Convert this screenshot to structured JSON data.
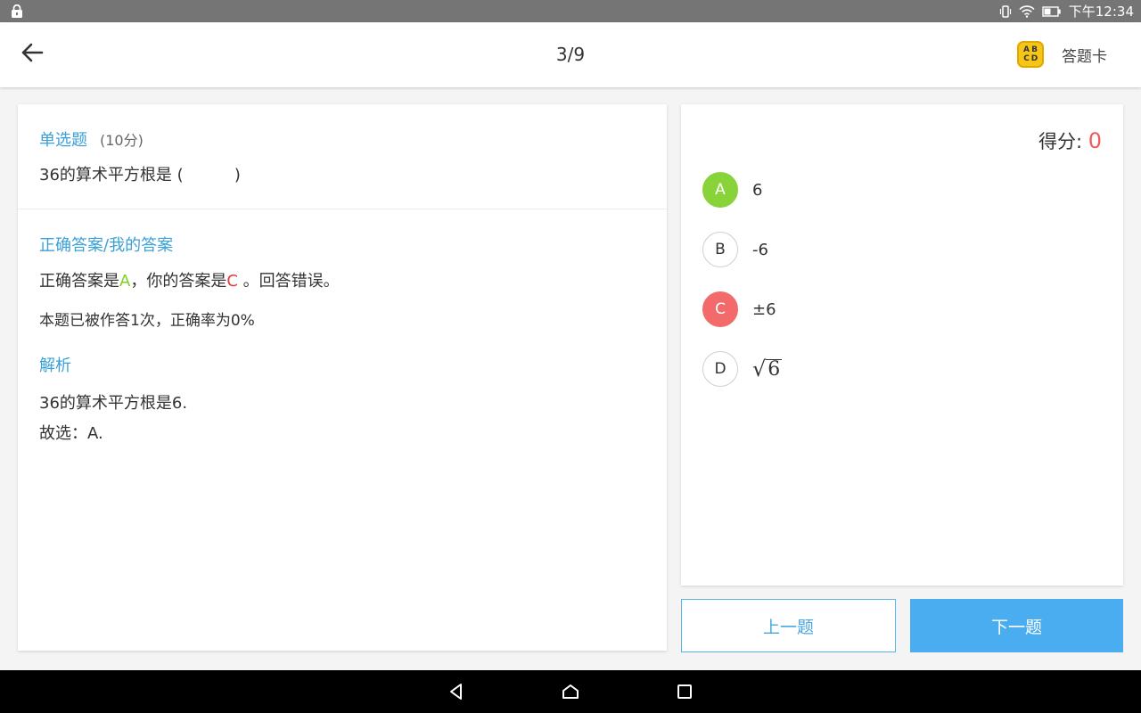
{
  "status_bar": {
    "time": "下午12:34"
  },
  "header": {
    "progress": "3/9",
    "answer_card_label": "答题卡",
    "answer_card_icon_letters": [
      "A",
      "B",
      "C",
      "D"
    ]
  },
  "question": {
    "type": "单选题",
    "score": "(10分)",
    "stem": "36的算术平方根是 (          )"
  },
  "answer": {
    "section_title": "正确答案/我的答案",
    "prefix": "正确答案是",
    "correct_letter": "A",
    "mid": "，你的答案是",
    "user_letter": "C",
    "suffix": " 。回答错误。",
    "stats": "本题已被作答1次，正确率为0%"
  },
  "analysis": {
    "title": "解析",
    "line1": "36的算术平方根是6.",
    "line2": "故选：A."
  },
  "right_panel": {
    "score_label": "得分: ",
    "score_value": "0",
    "options": [
      {
        "letter": "A",
        "text": "6",
        "state": "correct"
      },
      {
        "letter": "B",
        "text": "-6",
        "state": "normal"
      },
      {
        "letter": "C",
        "text": "±6",
        "state": "wrong"
      },
      {
        "letter": "D",
        "text": "6",
        "state": "normal",
        "format": "sqrt"
      }
    ]
  },
  "nav_buttons": {
    "prev": "上一题",
    "next": "下一题"
  },
  "colors": {
    "accent_blue": "#3aa0d6",
    "correct_green": "#88d33a",
    "wrong_red": "#f36a6a",
    "button_blue": "#4aadf0"
  }
}
